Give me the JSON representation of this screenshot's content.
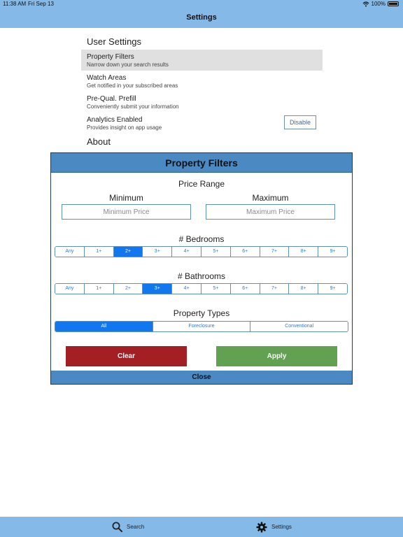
{
  "status_bar": {
    "time": "11:38 AM",
    "date": "Fri Sep 13",
    "battery": "100%",
    "wifi_icon": "wifi-icon",
    "battery_icon": "battery-icon"
  },
  "nav": {
    "title": "Settings"
  },
  "settings": {
    "section_title": "User Settings",
    "rows": [
      {
        "title": "Property Filters",
        "subtitle": "Narrow down your search results"
      },
      {
        "title": "Watch Areas",
        "subtitle": "Get notified in your subscribed areas"
      },
      {
        "title": "Pre-Qual. Prefill",
        "subtitle": "Conveniently submit your information"
      },
      {
        "title": "Analytics Enabled",
        "subtitle": "Provides insight on app usage",
        "button": "Disable"
      }
    ],
    "about_title": "About"
  },
  "modal": {
    "title": "Property Filters",
    "price_range": {
      "label": "Price Range",
      "min_label": "Minimum",
      "max_label": "Maximum",
      "min_placeholder": "Minimum Price",
      "max_placeholder": "Maximum Price"
    },
    "bedrooms": {
      "label": "# Bedrooms",
      "options": [
        "Any",
        "1+",
        "2+",
        "3+",
        "4+",
        "5+",
        "6+",
        "7+",
        "8+",
        "9+"
      ],
      "selected": "2+"
    },
    "bathrooms": {
      "label": "# Bathrooms",
      "options": [
        "Any",
        "1+",
        "2+",
        "3+",
        "4+",
        "5+",
        "6+",
        "7+",
        "8+",
        "9+"
      ],
      "selected": "3+"
    },
    "property_types": {
      "label": "Property Types",
      "options": [
        "All",
        "Foreclosure",
        "Conventional"
      ],
      "selected": "All"
    },
    "clear_label": "Clear",
    "apply_label": "Apply",
    "close_label": "Close",
    "colors": {
      "clear": "#a31f24",
      "apply": "#62a052",
      "header": "#4a89c2",
      "selected_segment": "#1177ee"
    }
  },
  "tabbar": {
    "search": {
      "label": "Search",
      "icon": "search-icon"
    },
    "settings": {
      "label": "Settings",
      "icon": "gear-icon"
    }
  }
}
